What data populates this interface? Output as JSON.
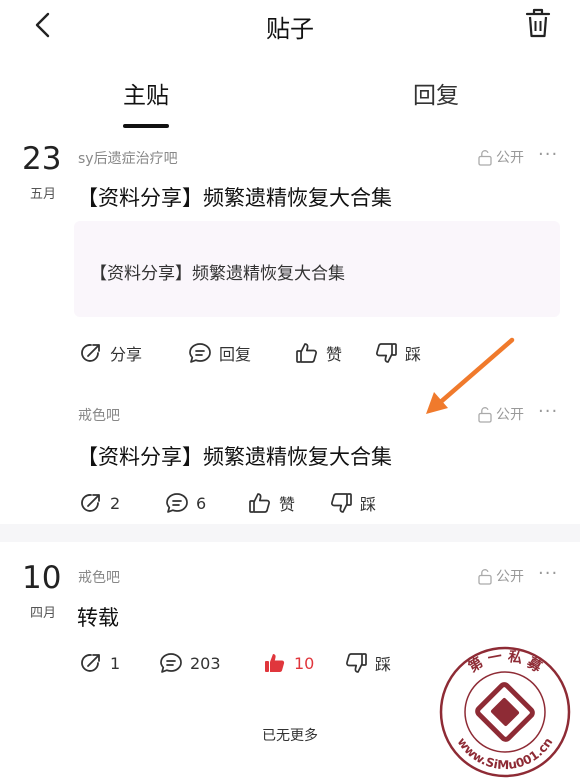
{
  "header": {
    "title": "贴子"
  },
  "tabs": [
    {
      "label": "主贴",
      "active": true
    },
    {
      "label": "回复",
      "active": false
    }
  ],
  "posts": [
    {
      "day": "23",
      "month": "五月",
      "forum": "sy后遗症治疗吧",
      "privacy": "公开",
      "title": "【资料分享】频繁遗精恢复大合集",
      "quote": "【资料分享】频繁遗精恢复大合集",
      "actions": {
        "share": "分享",
        "reply": "回复",
        "like": "赞",
        "dislike": "踩"
      }
    },
    {
      "forum": "戒色吧",
      "privacy": "公开",
      "title": "【资料分享】频繁遗精恢复大合集",
      "actions": {
        "share": "2",
        "reply": "6",
        "like": "赞",
        "dislike": "踩"
      }
    },
    {
      "day": "10",
      "month": "四月",
      "forum": "戒色吧",
      "privacy": "公开",
      "title": "转载",
      "actions": {
        "share": "1",
        "reply": "203",
        "like": "10",
        "dislike": "踩"
      }
    }
  ],
  "footer": {
    "no_more": "已无更多"
  },
  "watermark": {
    "text": "第一私募 www.SiMu001.cn"
  },
  "colors": {
    "accent_red": "#e0363c",
    "arrow": "#f07a2c",
    "stamp": "#8e2b35"
  }
}
